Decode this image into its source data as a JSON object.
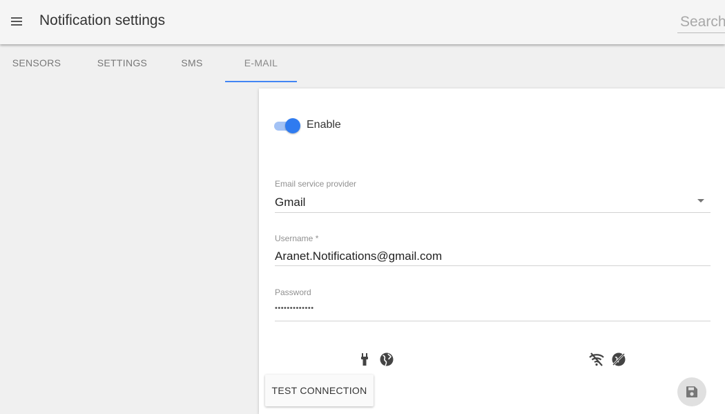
{
  "header": {
    "title": "Notification settings",
    "search_placeholder": "Search"
  },
  "tabs": [
    {
      "label": "SENSORS",
      "active": false
    },
    {
      "label": "SETTINGS",
      "active": false
    },
    {
      "label": "SMS",
      "active": false
    },
    {
      "label": "E-MAIL",
      "active": true
    }
  ],
  "email_form": {
    "enable": {
      "label": "Enable",
      "checked": true
    },
    "provider": {
      "label": "Email service provider",
      "value": "Gmail"
    },
    "username": {
      "label": "Username *",
      "value": "Aranet.Notifications@gmail.com"
    },
    "password": {
      "label": "Password",
      "value": "•••••••••••••"
    },
    "status_icons": [
      "plug-icon",
      "globe-icon",
      "wifi-off-icon",
      "no-connection-icon"
    ],
    "test_button": "TEST CONNECTION",
    "save_icon": "save-icon"
  },
  "colors": {
    "accent": "#4285f4",
    "toggle_thumb": "#2f7bf0",
    "toggle_track": "#a3c2f5",
    "background": "#f0f0f0",
    "card": "#ffffff"
  }
}
